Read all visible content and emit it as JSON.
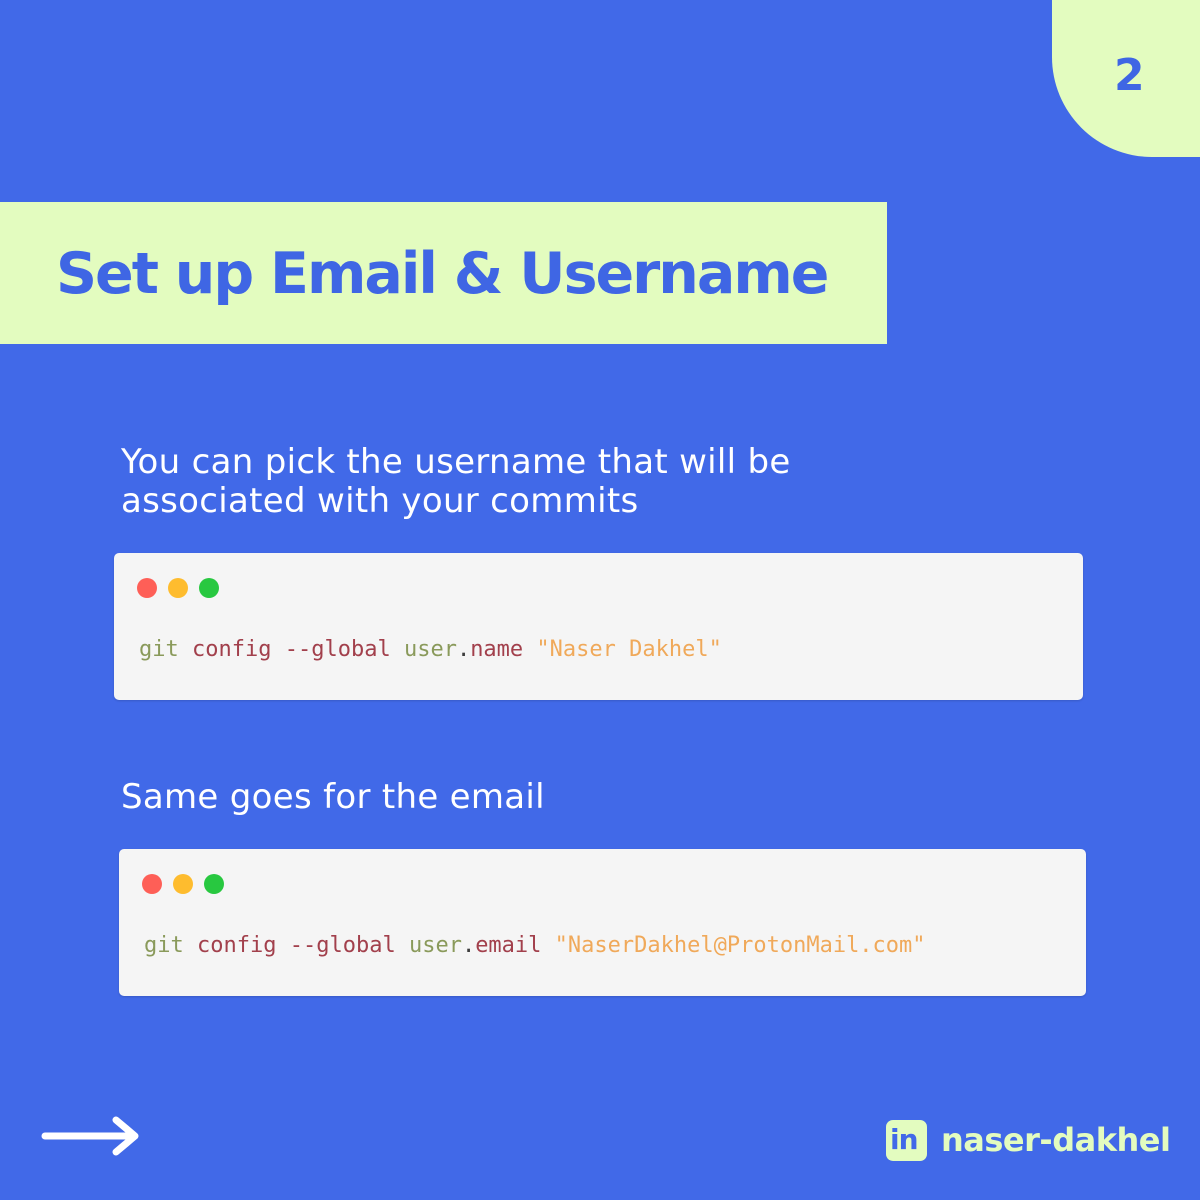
{
  "page_number": "2",
  "title": "Set up Email & Username",
  "sections": [
    {
      "caption": "You can pick the username that will be associated with your commits",
      "code": {
        "cmd": "git",
        "sub": "config",
        "flag": "--global",
        "key_obj": "user",
        "key_sep": ".",
        "key_prop": "name",
        "value": "\"Naser Dakhel\""
      }
    },
    {
      "caption": "Same goes for the email",
      "code": {
        "cmd": "git",
        "sub": "config",
        "flag": "--global",
        "key_obj": "user",
        "key_sep": ".",
        "key_prop": "email",
        "value": "\"NaserDakhel@ProtonMail.com\""
      }
    }
  ],
  "footer": {
    "next_icon": "arrow-right-icon",
    "social_icon": "linkedin-icon",
    "social_icon_text": "in",
    "handle": "naser-dakhel"
  },
  "colors": {
    "background": "#4169e8",
    "accent": "#e3fcbf",
    "code_bg": "#f5f5f5"
  }
}
